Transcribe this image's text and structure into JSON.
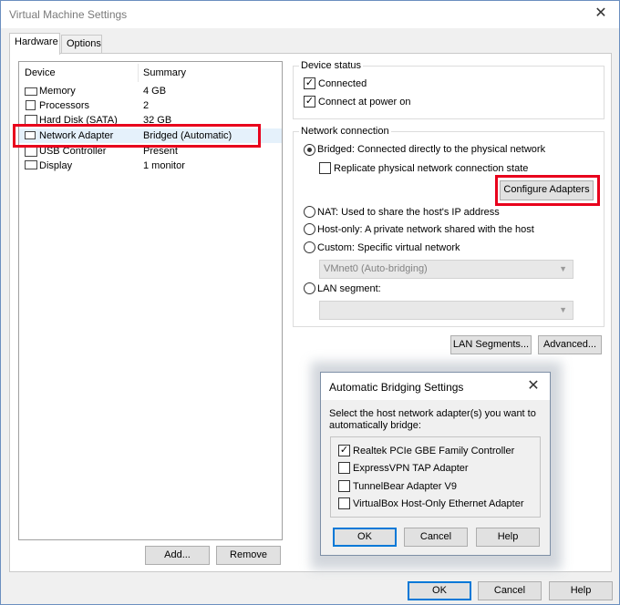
{
  "window": {
    "title": "Virtual Machine Settings",
    "close_glyph": "✕"
  },
  "tabs": [
    {
      "label": "Hardware"
    },
    {
      "label": "Options"
    }
  ],
  "device_list": {
    "col_device": "Device",
    "col_summary": "Summary",
    "rows": [
      {
        "name": "Memory",
        "summary": "4 GB",
        "icon": "memory-icon"
      },
      {
        "name": "Processors",
        "summary": "2",
        "icon": "processor-icon"
      },
      {
        "name": "Hard Disk (SATA)",
        "summary": "32 GB",
        "icon": "hard-disk-icon"
      },
      {
        "name": "Network Adapter",
        "summary": "Bridged (Automatic)",
        "icon": "network-adapter-icon",
        "selected": true
      },
      {
        "name": "USB Controller",
        "summary": "Present",
        "icon": "usb-icon"
      },
      {
        "name": "Display",
        "summary": "1 monitor",
        "icon": "display-icon"
      }
    ]
  },
  "list_buttons": {
    "add": "Add...",
    "remove": "Remove"
  },
  "device_status": {
    "label": "Device status",
    "connected": {
      "label": "Connected",
      "checked": true
    },
    "connect_power_on": {
      "label": "Connect at power on",
      "checked": true
    }
  },
  "network_connection": {
    "label": "Network connection",
    "bridged": "Bridged: Connected directly to the physical network",
    "replicate": "Replicate physical network connection state",
    "configure_adapters": "Configure Adapters",
    "nat": "NAT: Used to share the host's IP address",
    "host_only": "Host-only: A private network shared with the host",
    "custom": "Custom: Specific virtual network",
    "vmnet_value": "VMnet0 (Auto-bridging)",
    "lan_segment": "LAN segment:",
    "lan_value": "",
    "selected": "bridged"
  },
  "bottom_row_buttons": {
    "lan_segments": "LAN Segments...",
    "advanced": "Advanced..."
  },
  "dialog_buttons": {
    "ok": "OK",
    "cancel": "Cancel",
    "help": "Help"
  },
  "bridging_dialog": {
    "title": "Automatic Bridging Settings",
    "close_glyph": "✕",
    "instruction": "Select the host network adapter(s) you want to automatically bridge:",
    "adapters": [
      {
        "label": "Realtek PCIe GBE Family Controller",
        "checked": true
      },
      {
        "label": "ExpressVPN TAP Adapter",
        "checked": false
      },
      {
        "label": "TunnelBear Adapter V9",
        "checked": false
      },
      {
        "label": "VirtualBox Host-Only Ethernet Adapter",
        "checked": false
      }
    ],
    "ok": "OK",
    "cancel": "Cancel",
    "help": "Help"
  },
  "colors": {
    "highlight": "#e8001c",
    "selection": "#e5f1fb",
    "focus": "#0078d7"
  }
}
